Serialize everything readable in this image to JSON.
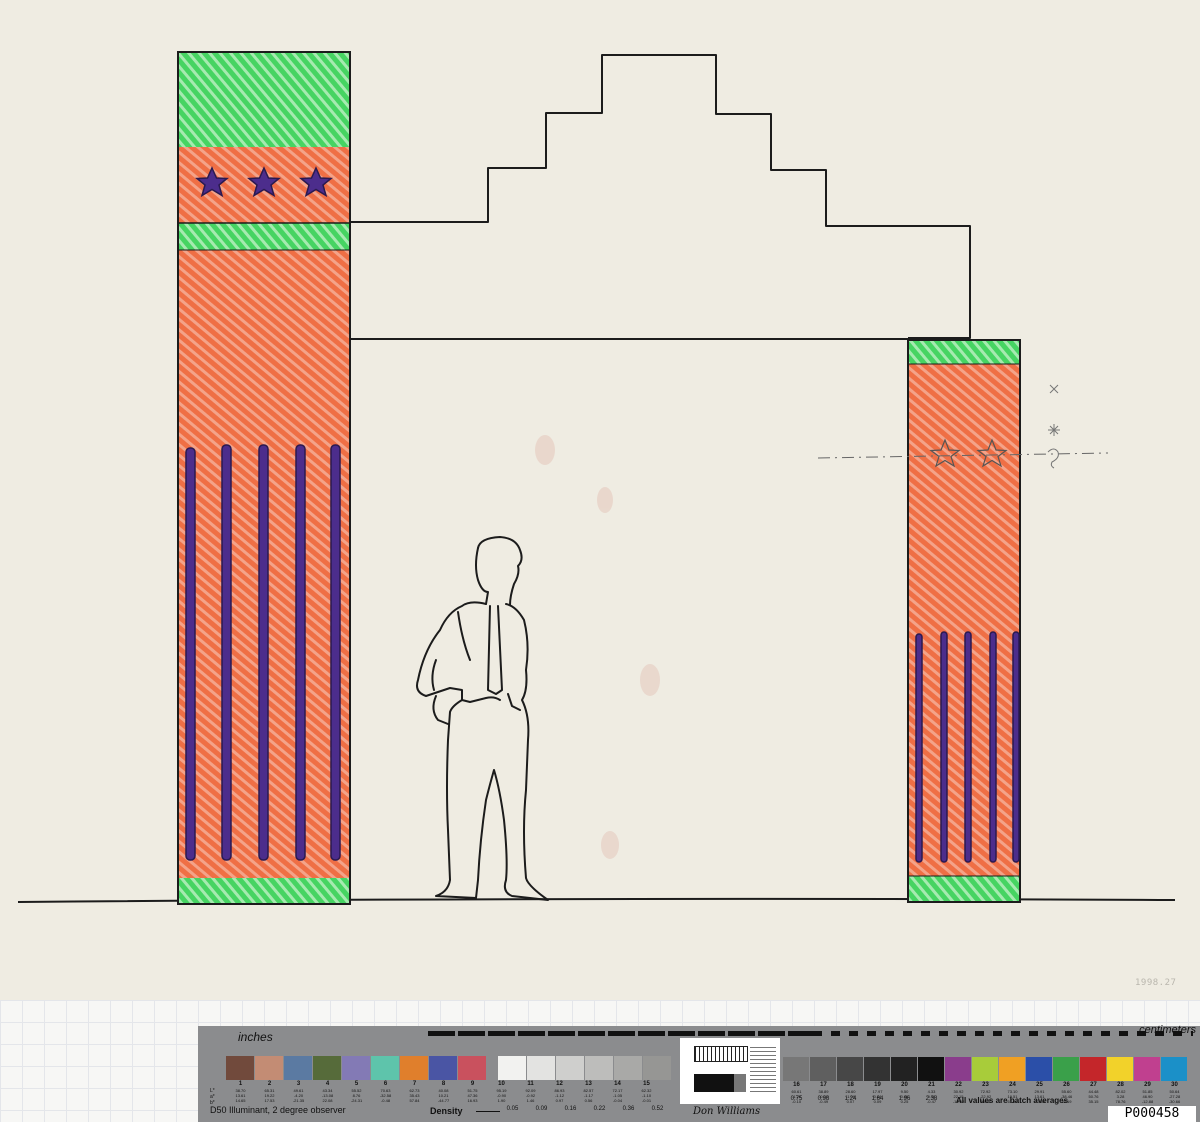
{
  "paper": {
    "color": "#efece2",
    "accession_number": "1998.27"
  },
  "colors": {
    "orange": "#f0764a",
    "green": "#4fd96a",
    "violet": "#4c2d8c",
    "ink": "#1c1c1c"
  },
  "card": {
    "label_inches": "inches",
    "label_centimeters": "centimeters",
    "illuminant": "D50 Illuminant, 2 degree observer",
    "density_label": "Density",
    "signature": "Don Williams",
    "all_values_note": "All values are batch averages",
    "identifier": "P000458",
    "lab_prefix": [
      "L*",
      "a*",
      "b*"
    ],
    "left_patches": [
      {
        "n": "1",
        "color": "#714a3c",
        "lab": [
          "38.70",
          "13.61",
          "14.65"
        ]
      },
      {
        "n": "2",
        "color": "#c38c74",
        "lab": [
          "65.31",
          "19.22",
          "17.53"
        ]
      },
      {
        "n": "3",
        "color": "#5b7aa2",
        "lab": [
          "49.61",
          "-4.20",
          "-21.35"
        ]
      },
      {
        "n": "4",
        "color": "#566b3a",
        "lab": [
          "43.34",
          "-13.08",
          "22.08"
        ]
      },
      {
        "n": "5",
        "color": "#837ab5",
        "lab": [
          "55.52",
          "8.76",
          "-24.31"
        ]
      },
      {
        "n": "6",
        "color": "#5ec4ab",
        "lab": [
          "70.63",
          "-32.58",
          "-0.48"
        ]
      },
      {
        "n": "7",
        "color": "#e07f2c",
        "lab": [
          "62.73",
          "35.43",
          "57.84"
        ]
      },
      {
        "n": "8",
        "color": "#4a55a4",
        "lab": [
          "40.08",
          "10.21",
          "-44.77"
        ]
      },
      {
        "n": "9",
        "color": "#c9515e",
        "lab": [
          "51.75",
          "47.36",
          "16.93"
        ]
      }
    ],
    "gray_patches": [
      {
        "n": "10",
        "color": "#f2f2f0",
        "lab": [
          "95.19",
          "-0.90",
          "1.90"
        ],
        "density": "0.05"
      },
      {
        "n": "11",
        "color": "#e3e3e1",
        "lab": [
          "92.09",
          "-0.92",
          "1.46"
        ],
        "density": "0.09"
      },
      {
        "n": "12",
        "color": "#cfcfcd",
        "lab": [
          "86.93",
          "-1.12",
          "0.97"
        ],
        "density": "0.16"
      },
      {
        "n": "13",
        "color": "#bdbdbb",
        "lab": [
          "82.57",
          "-1.17",
          "0.56"
        ],
        "density": "0.22"
      },
      {
        "n": "14",
        "color": "#a9a9a7",
        "lab": [
          "72.17",
          "-1.05",
          "-0.04"
        ],
        "density": "0.36"
      },
      {
        "n": "15",
        "color": "#969694",
        "lab": [
          "62.32",
          "-1.10",
          "-0.01"
        ],
        "density": "0.52"
      }
    ],
    "right_patches": [
      {
        "n": "16",
        "color": "#777777",
        "lab": [
          "60.61",
          "-1.29",
          "-0.10"
        ],
        "density": "0.75"
      },
      {
        "n": "17",
        "color": "#5f5f5f",
        "lab": [
          "38.89",
          "-0.22",
          "-0.49"
        ],
        "density": "0.98"
      },
      {
        "n": "18",
        "color": "#474747",
        "lab": [
          "28.60",
          "-1.09",
          "0.07"
        ],
        "density": "1.24"
      },
      {
        "n": "19",
        "color": "#333333",
        "lab": [
          "17.97",
          "0.04",
          "0.09"
        ],
        "density": "1.64"
      },
      {
        "n": "20",
        "color": "#222222",
        "lab": [
          "9.50",
          "0.45",
          "0.25"
        ],
        "density": "1.96"
      },
      {
        "n": "21",
        "color": "#111111",
        "lab": [
          "4.33",
          "0.32",
          "-0.47"
        ],
        "density": "2.38"
      },
      {
        "n": "22",
        "color": "#8a3d8c",
        "lab": [
          "30.92",
          "22.15",
          "-19.02"
        ],
        "density": ""
      },
      {
        "n": "23",
        "color": "#a8cc3a",
        "lab": [
          "72.92",
          "-22.92",
          "56.08"
        ],
        "density": ""
      },
      {
        "n": "24",
        "color": "#f0a023",
        "lab": [
          "73.10",
          "19.51",
          "67.85"
        ],
        "density": ""
      },
      {
        "n": "25",
        "color": "#2b4fa8",
        "lab": [
          "29.91",
          "13.61",
          "-47.68"
        ],
        "density": ""
      },
      {
        "n": "26",
        "color": "#3aa04a",
        "lab": [
          "55.60",
          "-38.46",
          "32.19"
        ],
        "density": ""
      },
      {
        "n": "27",
        "color": "#c4262a",
        "lab": [
          "44.48",
          "50.76",
          "35.15"
        ],
        "density": ""
      },
      {
        "n": "28",
        "color": "#f2d22a",
        "lab": [
          "82.02",
          "3.28",
          "78.76"
        ],
        "density": ""
      },
      {
        "n": "29",
        "color": "#c0408f",
        "lab": [
          "51.85",
          "46.90",
          "-12.88"
        ],
        "density": ""
      },
      {
        "n": "30",
        "color": "#1b90c8",
        "lab": [
          "50.64",
          "-27.28",
          "-30.66"
        ],
        "density": ""
      }
    ]
  }
}
